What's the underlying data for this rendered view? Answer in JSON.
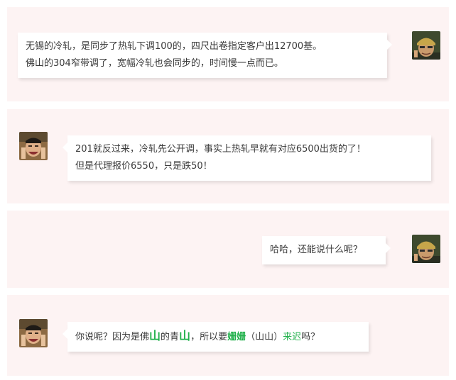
{
  "colors": {
    "panel": "#fdf3f3",
    "bubble": "#ffffff",
    "highlight": "#22b14c"
  },
  "messages": [
    {
      "side": "right",
      "avatar_icon": "man-with-beanie-avatar-icon",
      "lines": [
        "无锡的冷轧，是同步了热轧下调100的，四尺出卷指定客户出12700基。",
        "佛山的304窄带调了，宽幅冷轧也会同步的，时间慢一点而已。"
      ]
    },
    {
      "side": "left",
      "avatar_icon": "laughing-man-avatar-icon",
      "lines": [
        "201就反过来，冷轧先公开调，事实上热轧早就有对应6500出货的了！",
        "但是代理报价6550，只是跌50！"
      ]
    },
    {
      "side": "right",
      "avatar_icon": "man-with-beanie-avatar-icon",
      "lines": [
        "哈哈，还能说什么呢？"
      ]
    },
    {
      "side": "left",
      "avatar_icon": "laughing-man-avatar-icon",
      "parts": [
        "你说呢？因为是佛",
        "山",
        "的青",
        "山",
        "，所以要",
        "姗姗",
        "（山山）",
        "来迟",
        "吗？"
      ]
    }
  ]
}
